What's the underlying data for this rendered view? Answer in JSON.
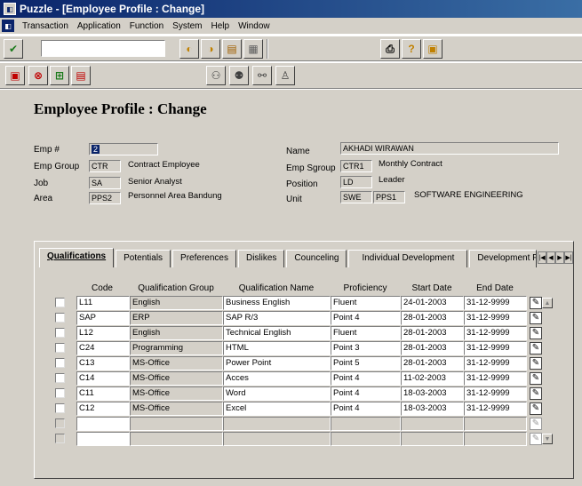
{
  "window": {
    "title": "Puzzle - [Employee Profile : Change]"
  },
  "menu": [
    "Transaction",
    "Application",
    "Function",
    "System",
    "Help",
    "Window"
  ],
  "page_title": "Employee Profile : Change",
  "fields": {
    "emp_no": {
      "label": "Emp #",
      "value": "2"
    },
    "emp_group": {
      "label": "Emp Group",
      "code": "CTR",
      "text": "Contract Employee"
    },
    "job": {
      "label": "Job",
      "code": "SA",
      "text": "Senior Analyst"
    },
    "area": {
      "label": "Area",
      "code": "PPS2",
      "text": "Personnel Area Bandung"
    },
    "name": {
      "label": "Name",
      "value": "AKHADI WIRAWAN"
    },
    "emp_sgroup": {
      "label": "Emp Sgroup",
      "code": "CTR1",
      "text": "Monthly Contract"
    },
    "position": {
      "label": "Position",
      "code": "LD",
      "text": "Leader"
    },
    "unit": {
      "label": "Unit",
      "code": "SWE",
      "code2": "PPS1",
      "text": "SOFTWARE ENGINEERING"
    }
  },
  "tabs": [
    "Qualifications",
    "Potentials",
    "Preferences",
    "Dislikes",
    "Counceling",
    "Individual Development",
    "Development Pl"
  ],
  "grid": {
    "columns": [
      "Code",
      "Qualification Group",
      "Qualification Name",
      "Proficiency",
      "Start Date",
      "End Date"
    ],
    "rows": [
      [
        "L11",
        "English",
        "Business English",
        "Fluent",
        "24-01-2003",
        "31-12-9999"
      ],
      [
        "SAP",
        "ERP",
        "SAP R/3",
        "Point 4",
        "28-01-2003",
        "31-12-9999"
      ],
      [
        "L12",
        "English",
        "Technical English",
        "Fluent",
        "28-01-2003",
        "31-12-9999"
      ],
      [
        "C24",
        "Programming",
        "HTML",
        "Point 3",
        "28-01-2003",
        "31-12-9999"
      ],
      [
        "C13",
        "MS-Office",
        "Power Point",
        "Point 5",
        "28-01-2003",
        "31-12-9999"
      ],
      [
        "C14",
        "MS-Office",
        "Acces",
        "Point 4",
        "11-02-2003",
        "31-12-9999"
      ],
      [
        "C11",
        "MS-Office",
        "Word",
        "Point 4",
        "18-03-2003",
        "31-12-9999"
      ],
      [
        "C12",
        "MS-Office",
        "Excel",
        "Point 4",
        "18-03-2003",
        "31-12-9999"
      ]
    ],
    "empty_rows": 2
  }
}
